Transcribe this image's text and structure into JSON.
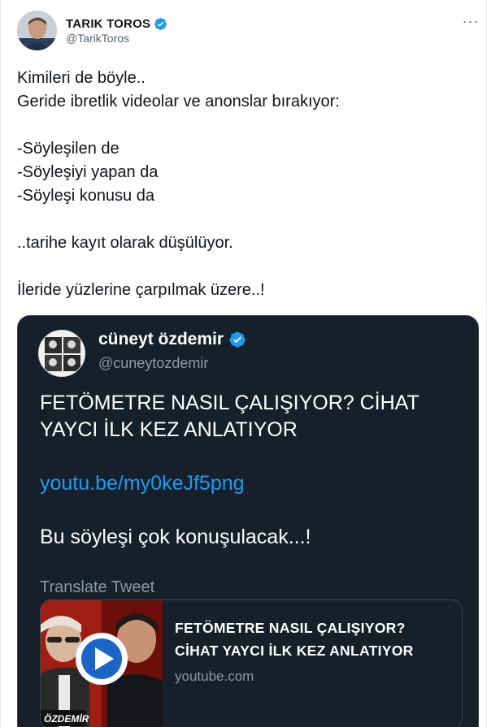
{
  "tweet": {
    "author": {
      "name": "TARIK TOROS",
      "handle": "@TarikToros"
    },
    "more_icon": "more-horizontal-icon",
    "text_lines": [
      "Kimileri de böyle..",
      "Geride ibretlik videolar ve anonslar bırakıyor:",
      "",
      "-Söyleşilen de",
      "-Söyleşiyi yapan da",
      "-Söyleşi konusu da",
      "",
      "..tarihe kayıt olarak düşülüyor.",
      "",
      "İleride yüzlerine çarpılmak üzere..!"
    ]
  },
  "quote": {
    "author": {
      "name": "cüneyt özdemir",
      "handle": "@cuneytozdemir"
    },
    "text_lines": [
      "FETÖMETRE NASIL ÇALIŞIYOR? CİHAT",
      "YAYCI İLK KEZ ANLATIYOR"
    ],
    "link": "youtu.be/my0keJf5png",
    "closing": "Bu söyleşi çok konuşulacak...!",
    "translate_label": "Translate Tweet",
    "card": {
      "title_lines": [
        "FETÖMETRE NASIL ÇALIŞIYOR?",
        "CİHAT YAYCI İLK KEZ ANLATIYOR"
      ],
      "domain": "youtube.com",
      "thumbnail_overlay": "ÖZDEMİR",
      "play_icon": "play-icon"
    }
  },
  "colors": {
    "verified": "#1d9bf0",
    "quote_bg": "#15202b",
    "link": "#1d9bf0"
  }
}
